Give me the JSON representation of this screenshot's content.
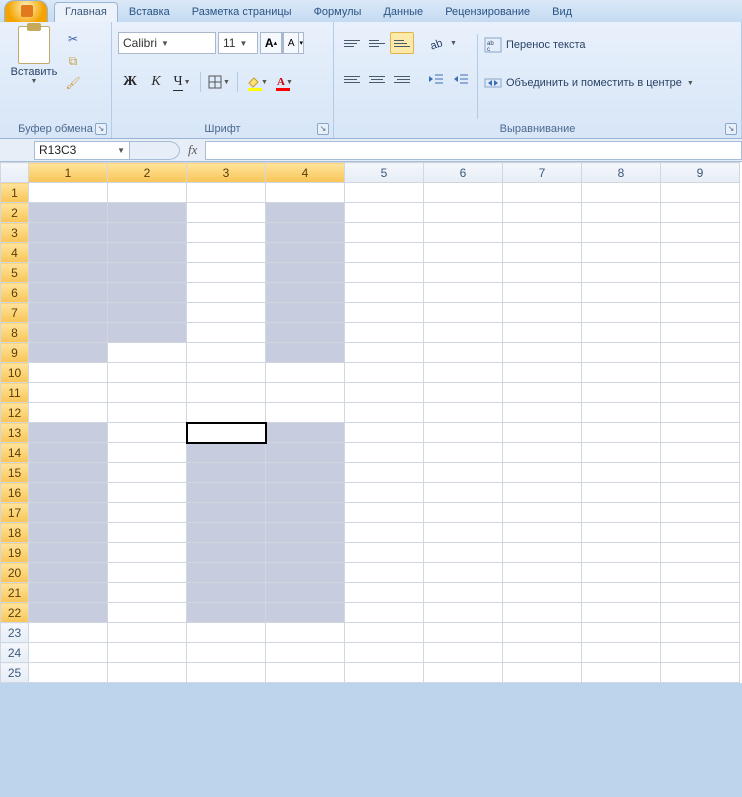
{
  "tabs": {
    "home": "Главная",
    "insert": "Вставка",
    "layout": "Разметка страницы",
    "formulas": "Формулы",
    "data": "Данные",
    "review": "Рецензирование",
    "view": "Вид"
  },
  "groups": {
    "clipboard": "Буфер обмена",
    "font": "Шрифт",
    "alignment": "Выравнивание"
  },
  "clipboard": {
    "paste": "Вставить"
  },
  "font": {
    "family": "Calibri",
    "size": "11",
    "grow": "A",
    "shrink": "A",
    "bold": "Ж",
    "italic": "К",
    "underline": "Ч"
  },
  "alignment": {
    "wrap": "Перенос текста",
    "merge": "Объединить и поместить в центре"
  },
  "formula_bar": {
    "name_box": "R13C3",
    "fx": "fx"
  },
  "columns": [
    "1",
    "2",
    "3",
    "4",
    "5",
    "6",
    "7",
    "8",
    "9"
  ],
  "rows": [
    "1",
    "2",
    "3",
    "4",
    "5",
    "6",
    "7",
    "8",
    "9",
    "10",
    "11",
    "12",
    "13",
    "14",
    "15",
    "16",
    "17",
    "18",
    "19",
    "20",
    "21",
    "22",
    "23",
    "24",
    "25"
  ],
  "selection": {
    "highlighted_cols": [
      1,
      2,
      3,
      4
    ],
    "highlighted_rows": [
      1,
      2,
      3,
      4,
      5,
      6,
      7,
      8,
      9,
      10,
      11,
      12,
      13,
      14,
      15,
      16,
      17,
      18,
      19,
      20,
      21,
      22
    ],
    "ranges": [
      {
        "cols": [
          1,
          2
        ],
        "rows": [
          2,
          3,
          4,
          5,
          6,
          7,
          8
        ]
      },
      {
        "cols": [
          1
        ],
        "rows": [
          9
        ]
      },
      {
        "cols": [
          4
        ],
        "rows": [
          2,
          3,
          4,
          5,
          6,
          7,
          8,
          9
        ]
      },
      {
        "cols": [
          1
        ],
        "rows": [
          13,
          14,
          15,
          16,
          17,
          18,
          19,
          20,
          21,
          22
        ]
      },
      {
        "cols": [
          3,
          4
        ],
        "rows": [
          14,
          15,
          16,
          17,
          18,
          19,
          20,
          21,
          22
        ]
      },
      {
        "cols": [
          4
        ],
        "rows": [
          13
        ]
      }
    ],
    "active": {
      "row": 13,
      "col": 3
    }
  }
}
